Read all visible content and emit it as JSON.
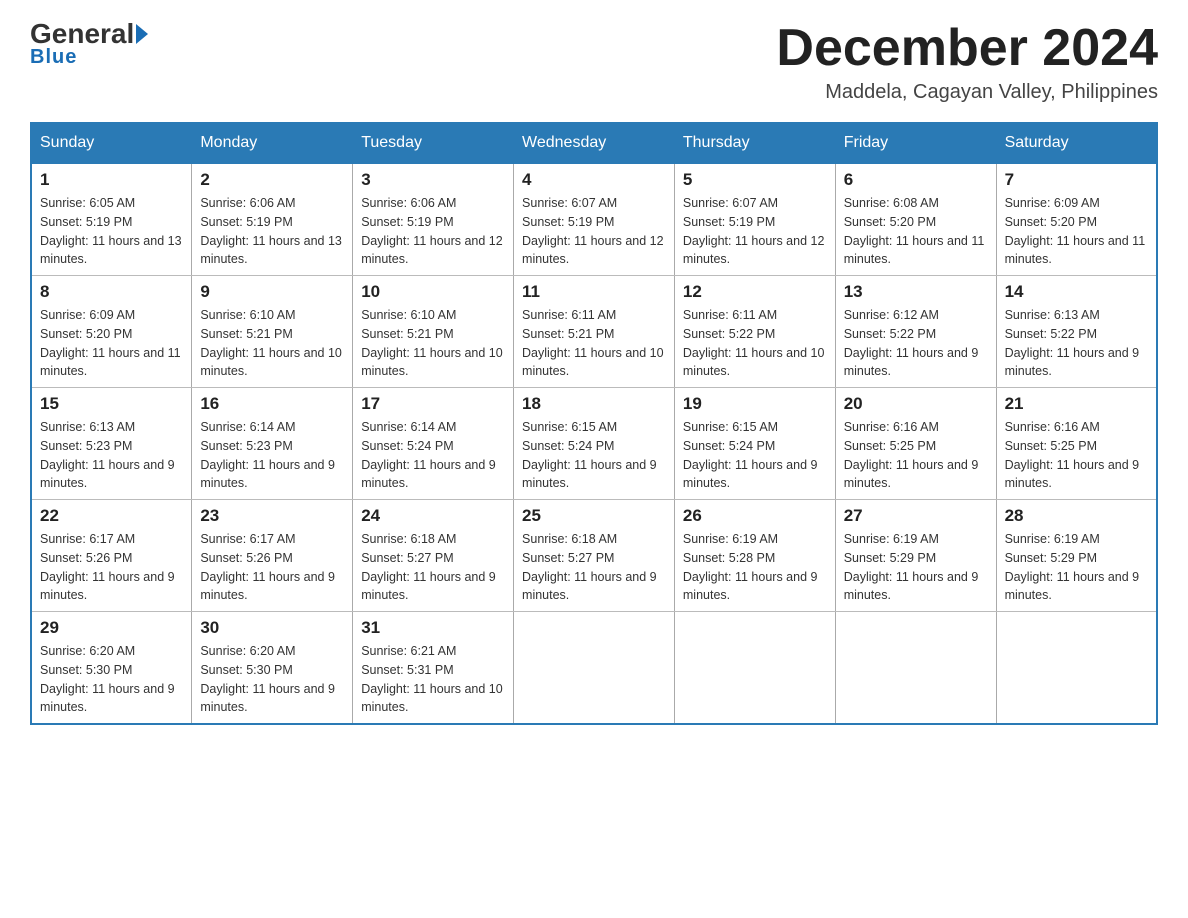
{
  "header": {
    "logo_general": "General",
    "logo_blue": "Blue",
    "month_title": "December 2024",
    "location": "Maddela, Cagayan Valley, Philippines"
  },
  "days_of_week": [
    "Sunday",
    "Monday",
    "Tuesday",
    "Wednesday",
    "Thursday",
    "Friday",
    "Saturday"
  ],
  "weeks": [
    [
      {
        "day": "1",
        "sunrise": "6:05 AM",
        "sunset": "5:19 PM",
        "daylight": "11 hours and 13 minutes."
      },
      {
        "day": "2",
        "sunrise": "6:06 AM",
        "sunset": "5:19 PM",
        "daylight": "11 hours and 13 minutes."
      },
      {
        "day": "3",
        "sunrise": "6:06 AM",
        "sunset": "5:19 PM",
        "daylight": "11 hours and 12 minutes."
      },
      {
        "day": "4",
        "sunrise": "6:07 AM",
        "sunset": "5:19 PM",
        "daylight": "11 hours and 12 minutes."
      },
      {
        "day": "5",
        "sunrise": "6:07 AM",
        "sunset": "5:19 PM",
        "daylight": "11 hours and 12 minutes."
      },
      {
        "day": "6",
        "sunrise": "6:08 AM",
        "sunset": "5:20 PM",
        "daylight": "11 hours and 11 minutes."
      },
      {
        "day": "7",
        "sunrise": "6:09 AM",
        "sunset": "5:20 PM",
        "daylight": "11 hours and 11 minutes."
      }
    ],
    [
      {
        "day": "8",
        "sunrise": "6:09 AM",
        "sunset": "5:20 PM",
        "daylight": "11 hours and 11 minutes."
      },
      {
        "day": "9",
        "sunrise": "6:10 AM",
        "sunset": "5:21 PM",
        "daylight": "11 hours and 10 minutes."
      },
      {
        "day": "10",
        "sunrise": "6:10 AM",
        "sunset": "5:21 PM",
        "daylight": "11 hours and 10 minutes."
      },
      {
        "day": "11",
        "sunrise": "6:11 AM",
        "sunset": "5:21 PM",
        "daylight": "11 hours and 10 minutes."
      },
      {
        "day": "12",
        "sunrise": "6:11 AM",
        "sunset": "5:22 PM",
        "daylight": "11 hours and 10 minutes."
      },
      {
        "day": "13",
        "sunrise": "6:12 AM",
        "sunset": "5:22 PM",
        "daylight": "11 hours and 9 minutes."
      },
      {
        "day": "14",
        "sunrise": "6:13 AM",
        "sunset": "5:22 PM",
        "daylight": "11 hours and 9 minutes."
      }
    ],
    [
      {
        "day": "15",
        "sunrise": "6:13 AM",
        "sunset": "5:23 PM",
        "daylight": "11 hours and 9 minutes."
      },
      {
        "day": "16",
        "sunrise": "6:14 AM",
        "sunset": "5:23 PM",
        "daylight": "11 hours and 9 minutes."
      },
      {
        "day": "17",
        "sunrise": "6:14 AM",
        "sunset": "5:24 PM",
        "daylight": "11 hours and 9 minutes."
      },
      {
        "day": "18",
        "sunrise": "6:15 AM",
        "sunset": "5:24 PM",
        "daylight": "11 hours and 9 minutes."
      },
      {
        "day": "19",
        "sunrise": "6:15 AM",
        "sunset": "5:24 PM",
        "daylight": "11 hours and 9 minutes."
      },
      {
        "day": "20",
        "sunrise": "6:16 AM",
        "sunset": "5:25 PM",
        "daylight": "11 hours and 9 minutes."
      },
      {
        "day": "21",
        "sunrise": "6:16 AM",
        "sunset": "5:25 PM",
        "daylight": "11 hours and 9 minutes."
      }
    ],
    [
      {
        "day": "22",
        "sunrise": "6:17 AM",
        "sunset": "5:26 PM",
        "daylight": "11 hours and 9 minutes."
      },
      {
        "day": "23",
        "sunrise": "6:17 AM",
        "sunset": "5:26 PM",
        "daylight": "11 hours and 9 minutes."
      },
      {
        "day": "24",
        "sunrise": "6:18 AM",
        "sunset": "5:27 PM",
        "daylight": "11 hours and 9 minutes."
      },
      {
        "day": "25",
        "sunrise": "6:18 AM",
        "sunset": "5:27 PM",
        "daylight": "11 hours and 9 minutes."
      },
      {
        "day": "26",
        "sunrise": "6:19 AM",
        "sunset": "5:28 PM",
        "daylight": "11 hours and 9 minutes."
      },
      {
        "day": "27",
        "sunrise": "6:19 AM",
        "sunset": "5:29 PM",
        "daylight": "11 hours and 9 minutes."
      },
      {
        "day": "28",
        "sunrise": "6:19 AM",
        "sunset": "5:29 PM",
        "daylight": "11 hours and 9 minutes."
      }
    ],
    [
      {
        "day": "29",
        "sunrise": "6:20 AM",
        "sunset": "5:30 PM",
        "daylight": "11 hours and 9 minutes."
      },
      {
        "day": "30",
        "sunrise": "6:20 AM",
        "sunset": "5:30 PM",
        "daylight": "11 hours and 9 minutes."
      },
      {
        "day": "31",
        "sunrise": "6:21 AM",
        "sunset": "5:31 PM",
        "daylight": "11 hours and 10 minutes."
      },
      null,
      null,
      null,
      null
    ]
  ]
}
